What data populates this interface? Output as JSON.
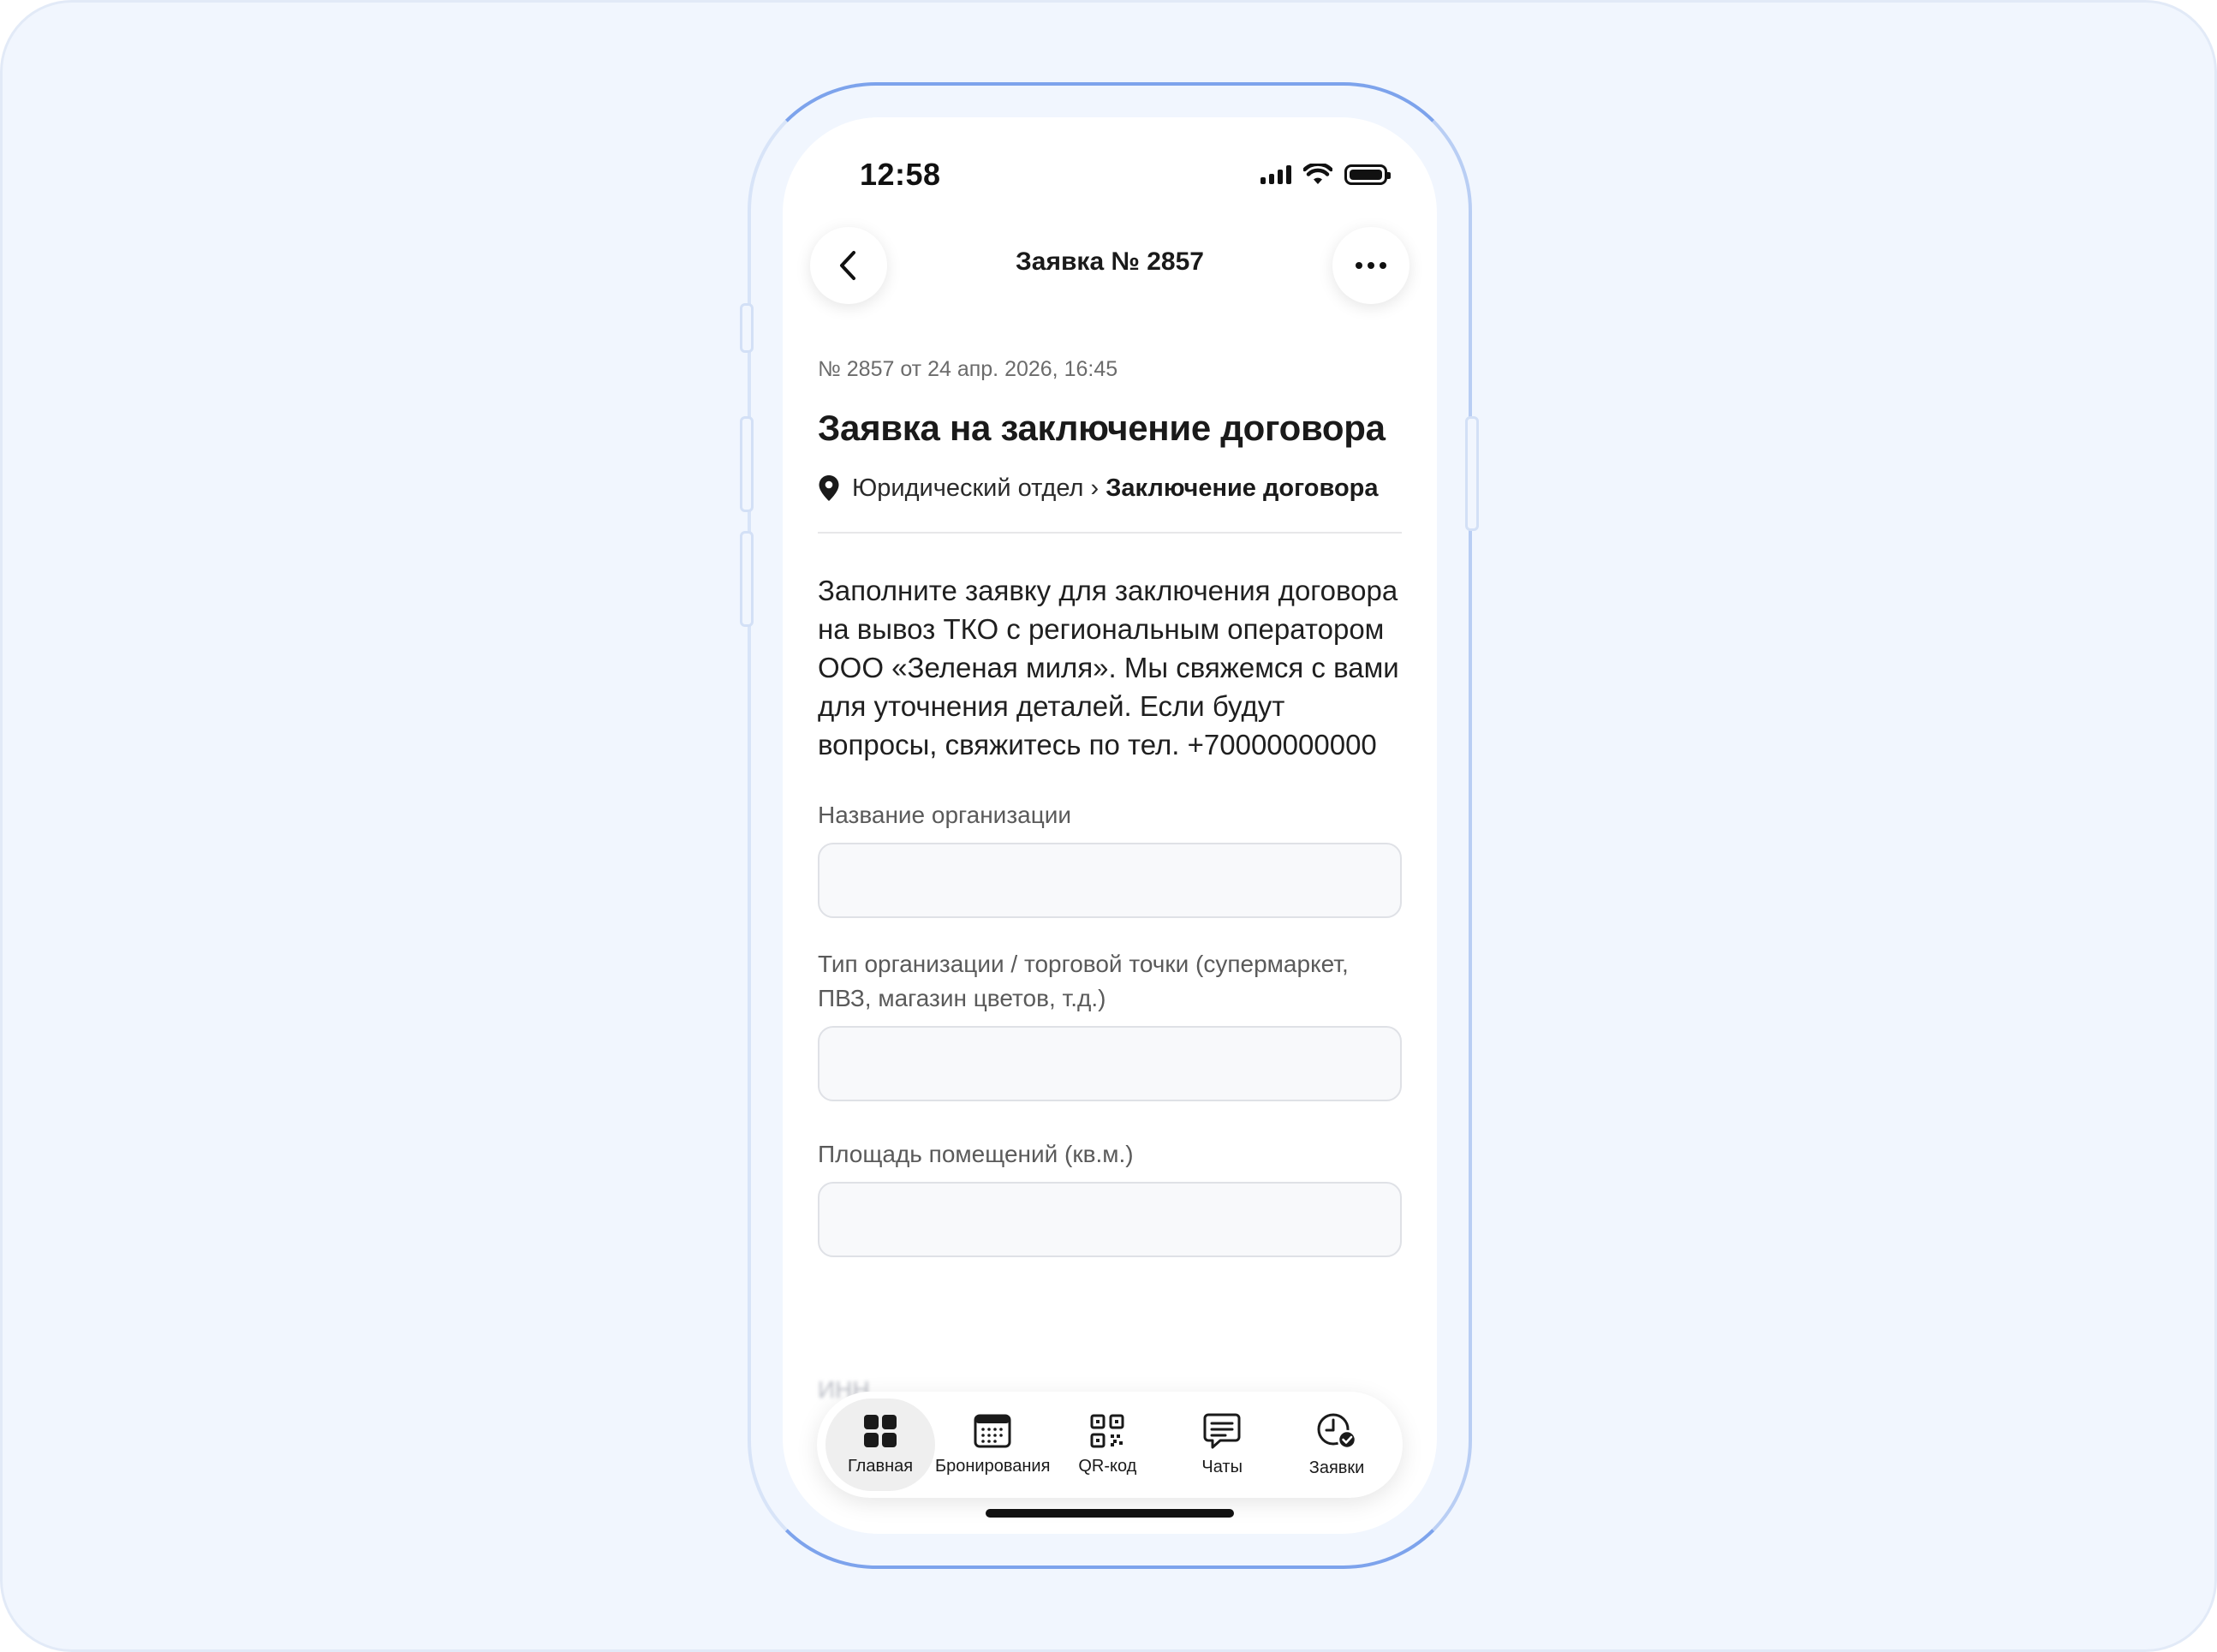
{
  "status_bar": {
    "time": "12:58"
  },
  "header": {
    "title": "Заявка № 2857"
  },
  "request": {
    "meta": "№ 2857 от 24 апр. 2026, 16:45",
    "title": "Заявка на заключение договора",
    "breadcrumb_department": "Юридический отдел",
    "breadcrumb_separator": "›",
    "breadcrumb_service": "Заключение договора",
    "description": "Заполните заявку для заключения договора на вывоз ТКО с региональным оператором ООО «Зеленая миля». Мы свяжемся с вами для уточнения деталей. Если будут вопросы, свяжитесь по тел. +70000000000"
  },
  "form": {
    "fields": [
      {
        "label": "Название организации",
        "value": ""
      },
      {
        "label": "Тип организации / торговой точки (супермаркет, ПВЗ, магазин цветов, т.д.)",
        "value": ""
      },
      {
        "label": "Площадь помещений (кв.м.)",
        "value": ""
      }
    ],
    "next_label_partial": "ИНН"
  },
  "tab_bar": {
    "items": [
      {
        "label": "Главная",
        "icon": "grid-icon",
        "active": true
      },
      {
        "label": "Бронирования",
        "icon": "calendar-icon",
        "active": false
      },
      {
        "label": "QR-код",
        "icon": "qr-code-icon",
        "active": false
      },
      {
        "label": "Чаты",
        "icon": "chat-icon",
        "active": false
      },
      {
        "label": "Заявки",
        "icon": "requests-clock-icon",
        "active": false
      }
    ]
  },
  "colors": {
    "background": "#f1f6fe",
    "frame_accent": "#7da3ec",
    "screen": "#ffffff",
    "input_bg": "#f8f9fb"
  }
}
